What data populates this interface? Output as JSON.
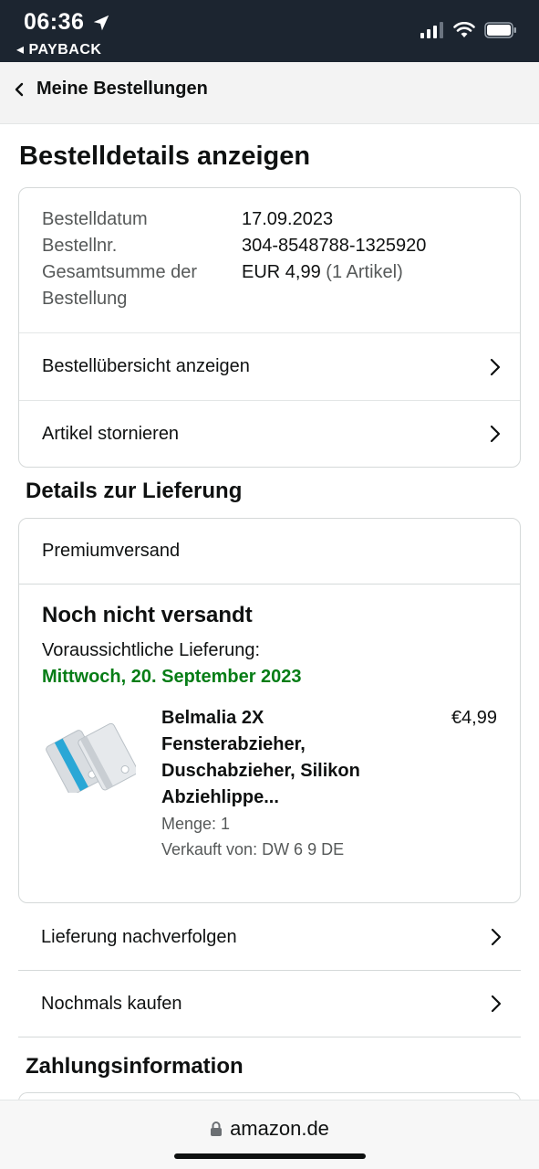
{
  "status_bar": {
    "time": "06:36",
    "back_app": "◂ PAYBACK"
  },
  "nav": {
    "back_label": "Meine Bestellungen"
  },
  "page_title": "Bestelldetails anzeigen",
  "order_info": {
    "date_label": "Bestelldatum",
    "date_value": "17.09.2023",
    "number_label": "Bestellnr.",
    "number_value": "304-8548788-1325920",
    "total_label": "Gesamtsumme der Bestellung",
    "total_value": "EUR 4,99",
    "total_items": "(1 Artikel)"
  },
  "order_links": [
    {
      "label": "Bestellübersicht anzeigen"
    },
    {
      "label": "Artikel stornieren"
    }
  ],
  "delivery": {
    "section_title": "Details zur Lieferung",
    "shipping_type": "Premiumversand",
    "status": "Noch nicht versandt",
    "expected_label": "Voraussichtliche Lieferung:",
    "expected_date": "Mittwoch, 20. September 2023",
    "product": {
      "title": "Belmalia 2X Fensterabzieher, Duschabzieher, Silikon Abziehlippe...",
      "price": "€4,99",
      "quantity": "Menge: 1",
      "seller": "Verkauft von: DW 6 9 DE",
      "colors": {
        "accent": "#2aa7d6",
        "body": "#d9dde1"
      }
    }
  },
  "delivery_links": [
    {
      "label": "Lieferung nachverfolgen"
    },
    {
      "label": "Nochmals kaufen"
    }
  ],
  "payment": {
    "section_title": "Zahlungsinformation"
  },
  "browser": {
    "url": "amazon.de"
  },
  "colors": {
    "status_bar_bg": "#1c2530",
    "delivery_green": "#067d16",
    "text": "#0f1111",
    "muted": "#565959"
  }
}
